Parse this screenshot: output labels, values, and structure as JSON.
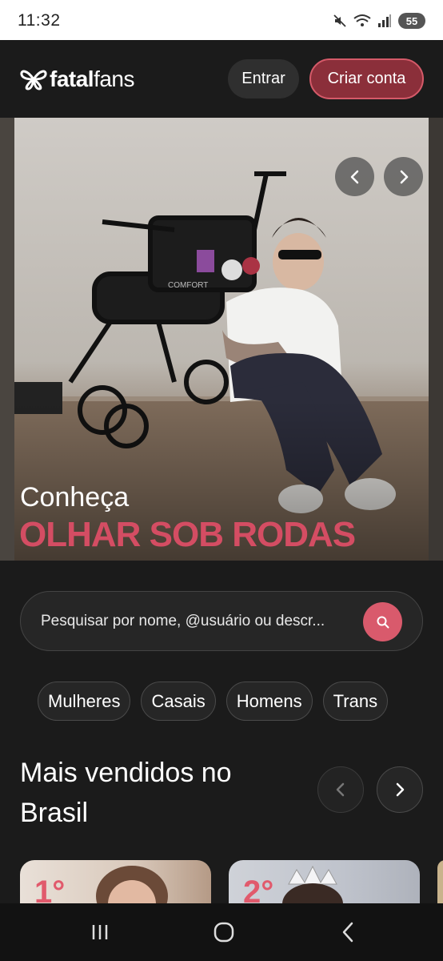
{
  "status_bar": {
    "time": "11:32",
    "battery": "55"
  },
  "header": {
    "logo_brand_light": "fatal",
    "logo_brand_bold": "fans",
    "login_label": "Entrar",
    "signup_label": "Criar conta"
  },
  "hero": {
    "kicker": "Conheça",
    "title": "OLHAR SOB RODAS",
    "sticker_text": "COMFORT"
  },
  "search": {
    "placeholder": "Pesquisar por nome, @usuário ou descr..."
  },
  "categories": [
    "Mulheres",
    "Casais",
    "Homens",
    "Trans"
  ],
  "section": {
    "title": "Mais vendidos no Brasil"
  },
  "cards": [
    {
      "rank": "1°"
    },
    {
      "rank": "2°"
    }
  ],
  "colors": {
    "accent": "#d95a6c",
    "signup_bg": "#8b2f3a",
    "background": "#1b1b1b"
  }
}
